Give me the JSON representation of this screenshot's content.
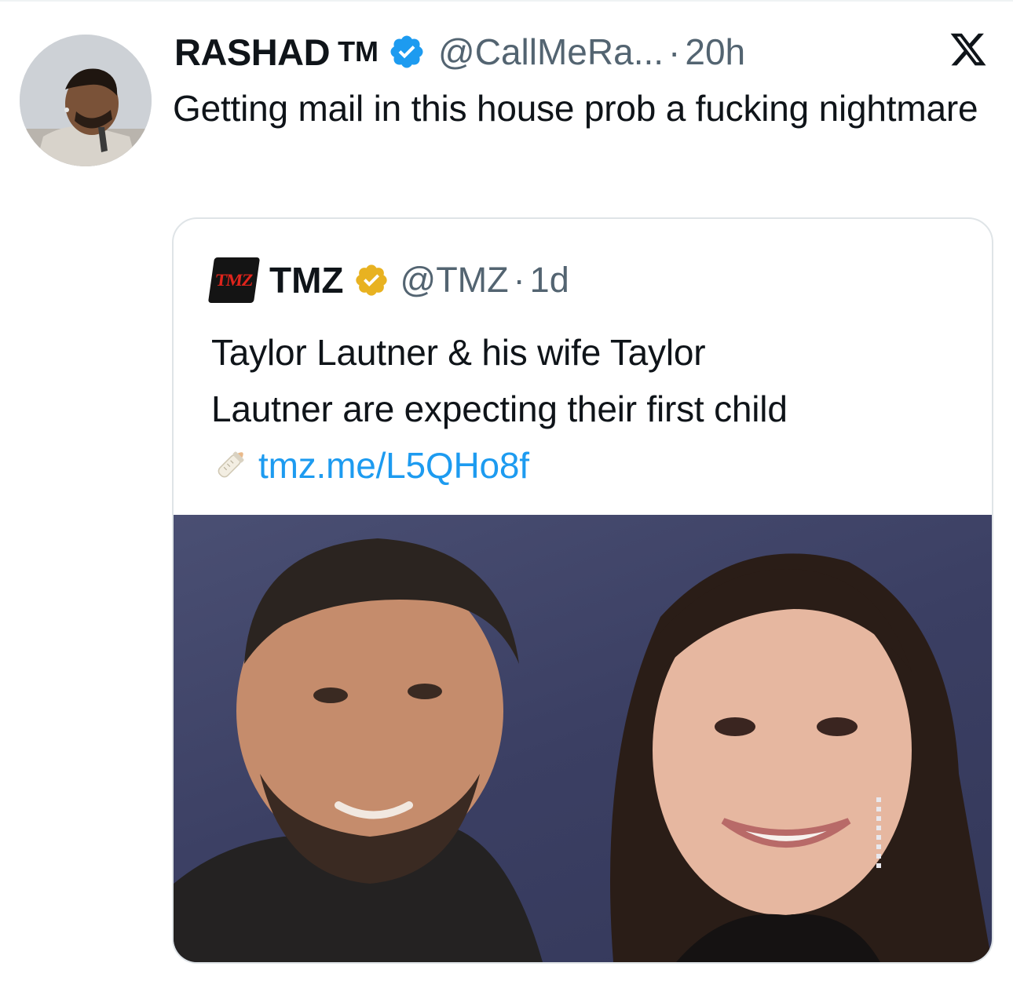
{
  "tweet": {
    "author": {
      "display_name": "RASHAD",
      "tm": "TM",
      "handle": "@CallMeRa...",
      "verified_color": "#1d9bf0"
    },
    "separator": "·",
    "time": "20h",
    "text": "Getting mail in this house prob a fucking nightmare",
    "platform_icon": "x-logo-icon"
  },
  "quoted_tweet": {
    "author": {
      "display_name": "TMZ",
      "handle": "@TMZ",
      "logo_text": "TMZ",
      "badge_color": "#e8b221"
    },
    "separator": "·",
    "time": "1d",
    "text_line_1": "Taylor Lautner & his wife Taylor",
    "text_line_2": "Lautner are expecting their first child",
    "emoji_icon": "baby-bottle-icon",
    "link": "tmz.me/L5QHo8f"
  },
  "colors": {
    "text_primary": "#0f1419",
    "text_secondary": "#536471",
    "link": "#1d9bf0",
    "border": "#dfe4e7"
  }
}
